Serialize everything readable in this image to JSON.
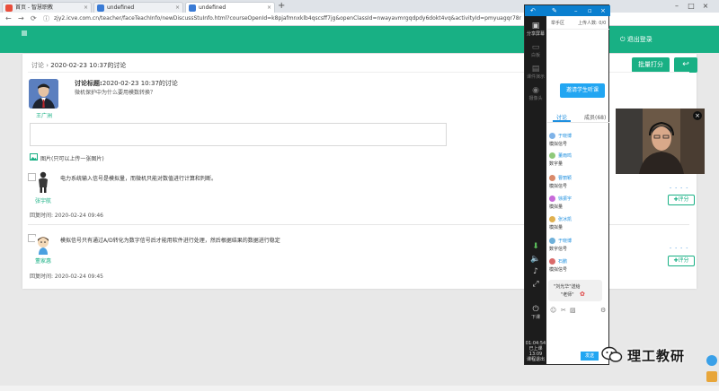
{
  "browser": {
    "tabs": [
      {
        "label": "首页 - 智慧职教",
        "active": false
      },
      {
        "label": "undefined",
        "active": false
      },
      {
        "label": "undefined",
        "active": true
      }
    ],
    "new_tab": "+",
    "url": "zjy2.icve.com.cn/teacher/faceTeachInfo/newDiscussStuInfo.html?courseOpenId=k8pjafmnxklb4qscsff7jg&openClassId=nwayavmrgqdpdy6dokt4vq&activityId=pmyuagqr78ncgbqqqmrs&"
  },
  "header": {
    "logout": "退出登录",
    "accent": "#18b084"
  },
  "discussion": {
    "breadcrumb_root": "讨论",
    "breadcrumb_sep": "›",
    "breadcrumb_current": "2020-02-23 10:37的讨论",
    "batch_grade": "批量打分",
    "back_icon": "↩",
    "teacher_name": "王广洲",
    "topic_label": "讨论标题:",
    "topic_title": "2020-02-23 10:37的讨论",
    "topic_body": "微机保护中为什么要用模数转换？",
    "image_hint": "图片(只可以上传一张图片)",
    "replies": [
      {
        "name": "张宇航",
        "text": "电力系统输入信号是模拟量，而微机只能对数值进行计算和判断。",
        "time_label": "回复时间: 2020-02-24 09:46",
        "dots": "- - - -",
        "eval": "评分"
      },
      {
        "name": "董家惠",
        "text": "模拟信号只有通过A/D转化为数字信号后才能用软件进行处理，然后根据结果的数据进行稳定",
        "time_label": "回复时间: 2020-02-24 09:45",
        "dots": "- - - -",
        "eval": "评分"
      }
    ]
  },
  "live": {
    "top_label": "下载",
    "side": [
      {
        "label": "分享屏幕",
        "icon": "screen-icon"
      },
      {
        "label": "白板",
        "icon": "whiteboard-icon"
      },
      {
        "label": "课件演示",
        "icon": "courseware-icon"
      },
      {
        "label": "摄像头",
        "icon": "camera-icon"
      }
    ],
    "head_left": "举手区",
    "head_right": "上传人数: 0/0",
    "invite": "邀请学生听课",
    "tab_discuss": "讨论",
    "tab_members": "成员(68)",
    "chat": [
      {
        "name": "于晓博",
        "msg": "模拟信号",
        "color": "#7fb3e8"
      },
      {
        "name": "董雨鸣",
        "msg": "数字量",
        "color": "#8fc97a"
      },
      {
        "name": "曹丽颖",
        "msg": "模拟信号",
        "color": "#d98a6a"
      },
      {
        "name": "徐振宇",
        "msg": "模拟量",
        "color": "#c76ad9"
      },
      {
        "name": "张冰凯",
        "msg": "模拟量",
        "color": "#e0b04f"
      },
      {
        "name": "于晓博",
        "msg": "数字信号",
        "color": "#6fb0d9"
      },
      {
        "name": "石鹏",
        "msg": "模拟信号",
        "color": "#d96a6a"
      }
    ],
    "bubble_line1": "\"刘光华\"送给",
    "bubble_line2": "\"老师\"",
    "end_class": "下课",
    "timer": "01:04:54",
    "timer_sub1": "已上课",
    "timer_sub2": "13:09",
    "timer_sub3": "课程退出",
    "send": "发送"
  },
  "watermark": "理工教研"
}
